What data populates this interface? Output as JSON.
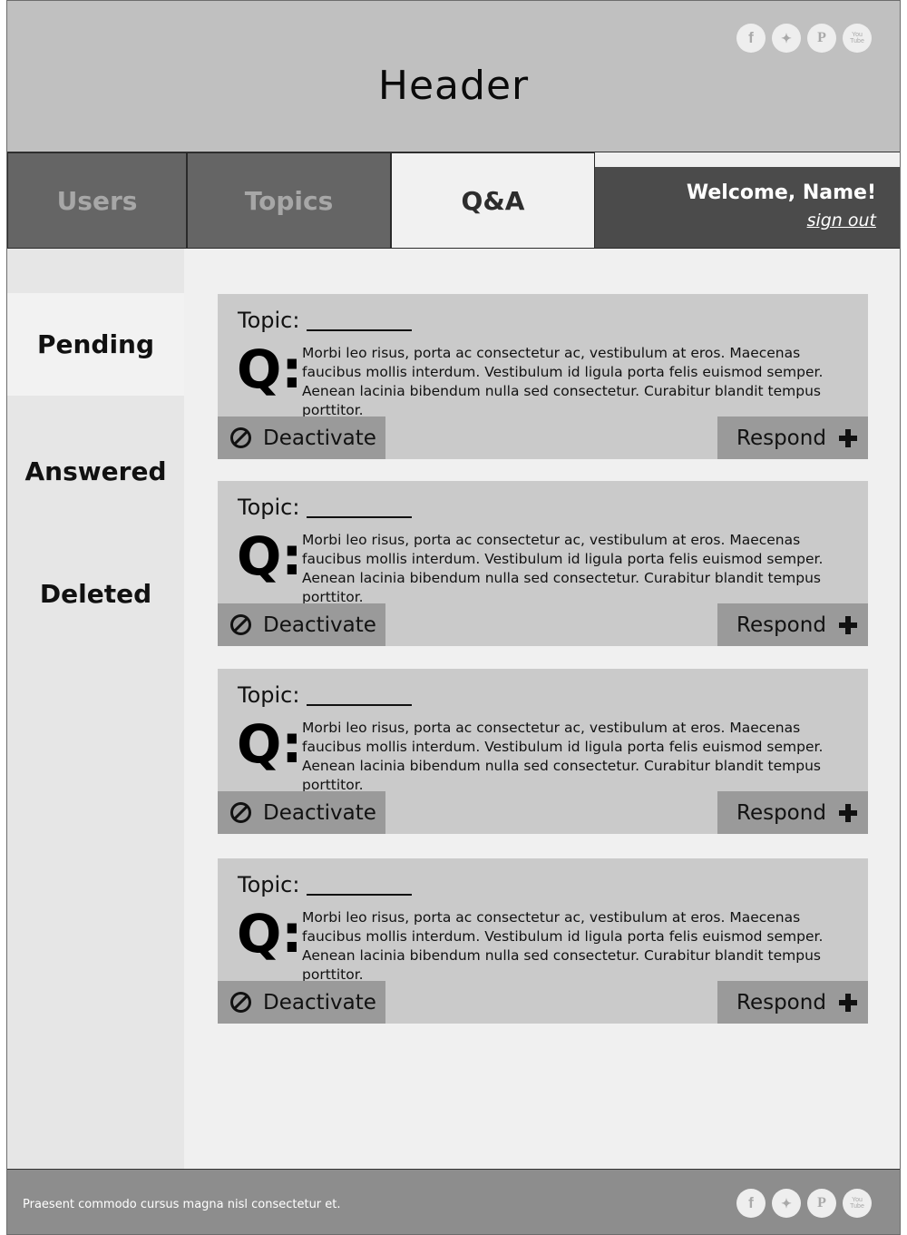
{
  "header": {
    "title": "Header",
    "social": [
      {
        "icon": "facebook-icon",
        "glyph": "f"
      },
      {
        "icon": "twitter-icon",
        "glyph": "t"
      },
      {
        "icon": "pinterest-icon",
        "glyph": "P"
      },
      {
        "icon": "youtube-icon",
        "glyph": "You Tube"
      }
    ]
  },
  "nav": {
    "tabs": [
      {
        "label": "Users",
        "active": false
      },
      {
        "label": "Topics",
        "active": false
      },
      {
        "label": "Q&A",
        "active": true
      }
    ],
    "welcome": "Welcome, Name!",
    "signout": "sign out"
  },
  "sidebar": {
    "items": [
      {
        "label": "Pending",
        "active": true
      },
      {
        "label": "Answered",
        "active": false
      },
      {
        "label": "Deleted",
        "active": false
      }
    ]
  },
  "questions": [
    {
      "topic_label": "Topic:",
      "q_label": "Q:",
      "text": "Morbi leo risus, porta ac consectetur ac, vestibulum at eros. Maecenas faucibus mollis interdum. Vestibulum id ligula porta felis euismod semper. Aenean lacinia bibendum nulla sed consectetur. Curabitur blandit tempus porttitor.",
      "deactivate_label": "Deactivate",
      "respond_label": "Respond"
    },
    {
      "topic_label": "Topic:",
      "q_label": "Q:",
      "text": "Morbi leo risus, porta ac consectetur ac, vestibulum at eros. Maecenas faucibus mollis interdum. Vestibulum id ligula porta felis euismod semper. Aenean lacinia bibendum nulla sed consectetur. Curabitur blandit tempus porttitor.",
      "deactivate_label": "Deactivate",
      "respond_label": "Respond"
    },
    {
      "topic_label": "Topic:",
      "q_label": "Q:",
      "text": "Morbi leo risus, porta ac consectetur ac, vestibulum at eros. Maecenas faucibus mollis interdum. Vestibulum id ligula porta felis euismod semper. Aenean lacinia bibendum nulla sed consectetur. Curabitur blandit tempus porttitor.",
      "deactivate_label": "Deactivate",
      "respond_label": "Respond"
    },
    {
      "topic_label": "Topic:",
      "q_label": "Q:",
      "text": "Morbi leo risus, porta ac consectetur ac, vestibulum at eros. Maecenas faucibus mollis interdum. Vestibulum id ligula porta felis euismod semper. Aenean lacinia bibendum nulla sed consectetur. Curabitur blandit tempus porttitor.",
      "deactivate_label": "Deactivate",
      "respond_label": "Respond"
    }
  ],
  "footer": {
    "text": "Praesent commodo cursus magna nisl consectetur et."
  },
  "colors": {
    "header_bg": "#c0c0c0",
    "nav_tab_bg": "#656565",
    "active_tab_bg": "#f1f1f1",
    "welcome_bg": "#4b4b4b",
    "card_bg": "#cacaca",
    "button_bg": "#9a9a9a",
    "footer_bg": "#8d8d8d"
  }
}
